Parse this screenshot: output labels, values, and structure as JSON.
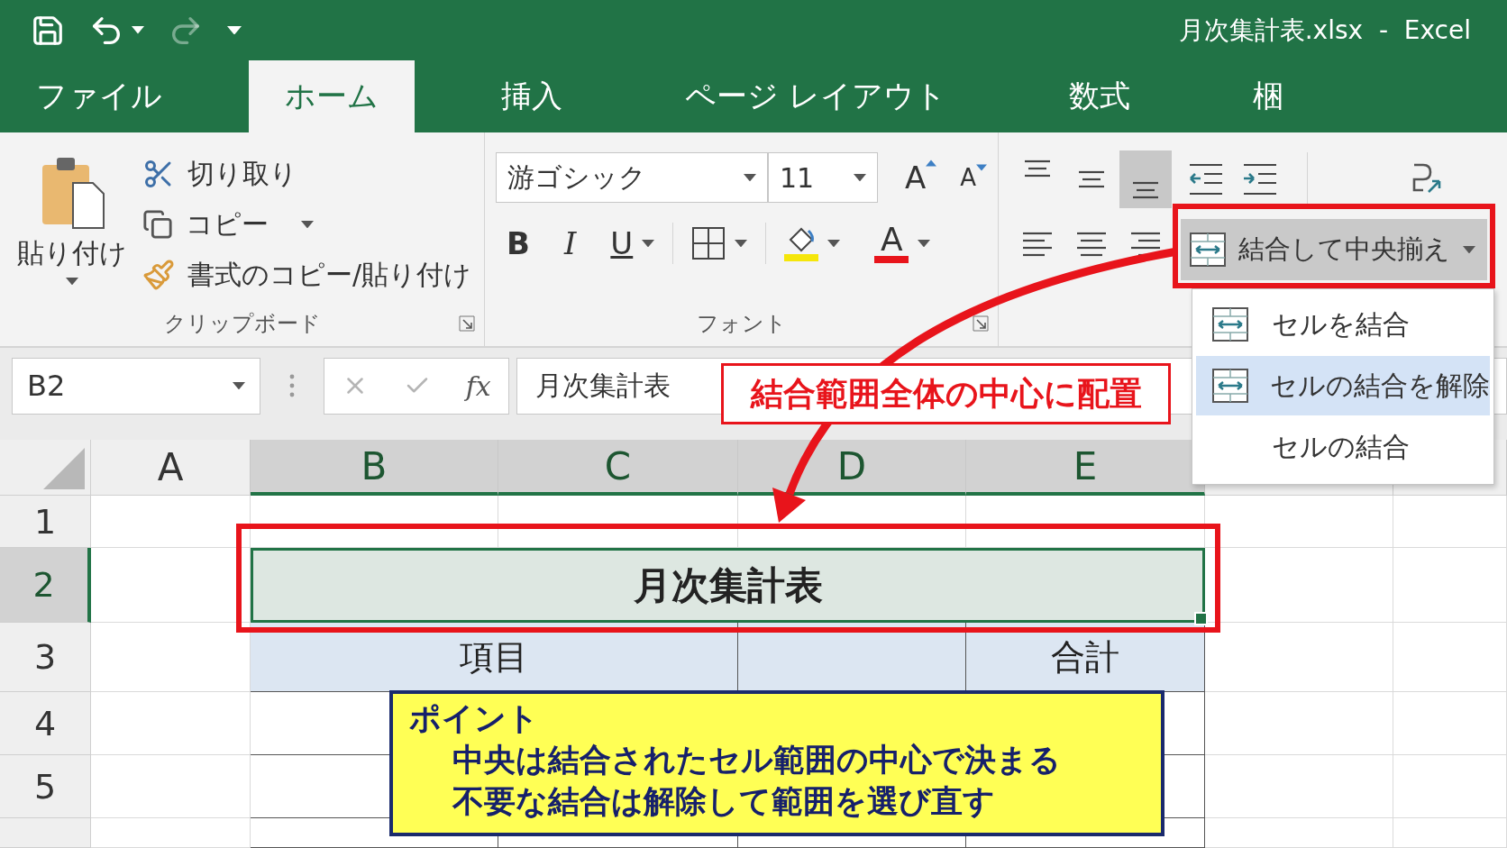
{
  "title_bar": {
    "title": "月次集計表.xlsx  -  Excel",
    "quick_access": [
      {
        "kind": "save",
        "disabled": false
      },
      {
        "kind": "undo",
        "disabled": false
      },
      {
        "kind": "redo",
        "disabled": true
      },
      {
        "kind": "customize",
        "disabled": false
      }
    ]
  },
  "tabs": [
    {
      "label": "ファイル",
      "selected": false
    },
    {
      "label": "ホーム",
      "selected": true
    },
    {
      "label": "挿入",
      "selected": false
    },
    {
      "label": "ページ レイアウト",
      "selected": false
    },
    {
      "label": "数式",
      "selected": false
    },
    {
      "label": "梱",
      "selected": false
    }
  ],
  "ribbon": {
    "clipboard": {
      "label": "クリップボード",
      "paste": "貼り付け",
      "cut": "切り取り",
      "copy": "コピー",
      "format_painter": "書式のコピー/貼り付け"
    },
    "font": {
      "label": "フォント",
      "font_name": "游ゴシック",
      "font_size": "11",
      "grow": "A",
      "shrink": "A",
      "bold": "B",
      "italic": "I",
      "underline": "U",
      "font_color": "A"
    },
    "alignment": {
      "vertical": [
        {
          "kind": "top",
          "selected": false
        },
        {
          "kind": "middle",
          "selected": false
        },
        {
          "kind": "bottom",
          "selected": true
        }
      ],
      "horizontal": [
        {
          "kind": "left",
          "selected": false
        },
        {
          "kind": "center",
          "selected": false
        },
        {
          "kind": "right",
          "selected": false
        }
      ],
      "merge_button": {
        "label": "結合して中央揃え",
        "pressed": true
      }
    },
    "merge_menu": [
      {
        "label": "セルを結合",
        "has_icon": true,
        "selected": false
      },
      {
        "label": "セルの結合を解除",
        "has_icon": true,
        "selected": true
      },
      {
        "label": "セルの結合",
        "has_icon": false,
        "selected": false
      }
    ]
  },
  "formula_bar": {
    "name_box": "B2",
    "fx": "fx",
    "formula": "月次集計表"
  },
  "sheet": {
    "columns": [
      {
        "label": "A",
        "selected": false
      },
      {
        "label": "B",
        "selected": true
      },
      {
        "label": "C",
        "selected": true
      },
      {
        "label": "D",
        "selected": true
      },
      {
        "label": "E",
        "selected": true
      }
    ],
    "rows": [
      {
        "label": "1",
        "kind": "blank",
        "selected": false
      },
      {
        "label": "2",
        "kind": "title",
        "selected": true,
        "text": "月次集計表"
      },
      {
        "label": "3",
        "kind": "table_header",
        "selected": false,
        "item": "項目",
        "total": "合計"
      },
      {
        "label": "4",
        "kind": "table_body",
        "selected": false
      },
      {
        "label": "5",
        "kind": "table_body",
        "selected": false
      }
    ]
  },
  "annotations": {
    "callout": "結合範囲全体の中心に配置",
    "point": {
      "title": "ポイント",
      "lines": [
        "中央は結合されたセル範囲の中心で決まる",
        "不要な結合は解除して範囲を選び直す"
      ]
    }
  }
}
